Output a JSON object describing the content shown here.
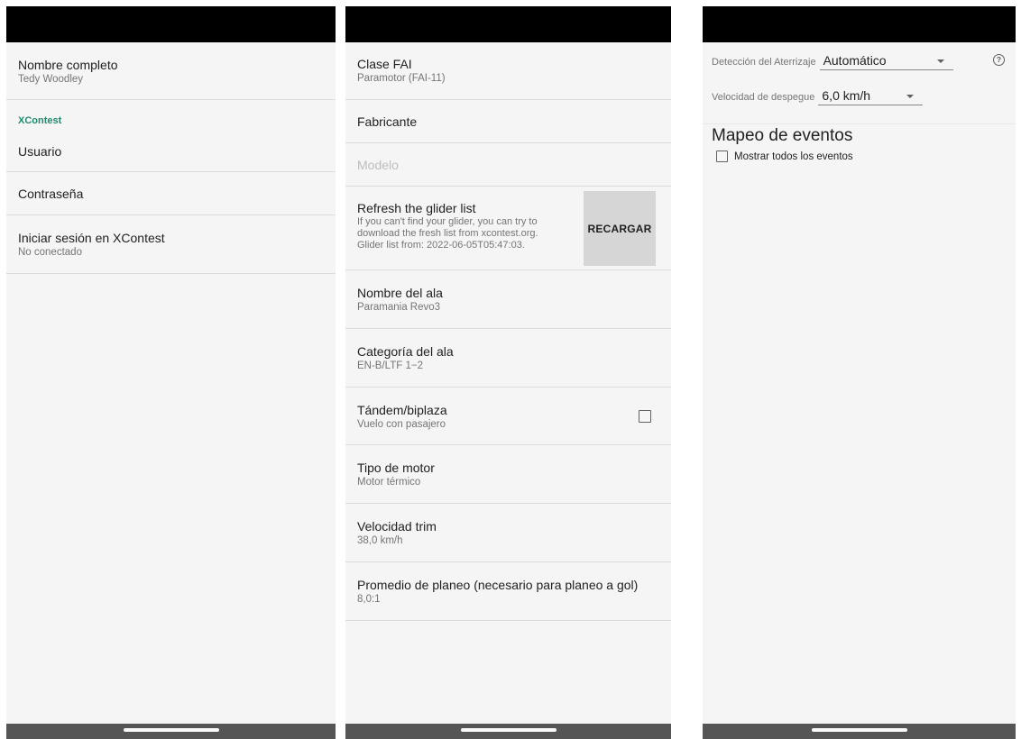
{
  "panel1": {
    "nombre": {
      "title": "Nombre completo",
      "summary": "Tedy Woodley"
    },
    "category": "XContest",
    "usuario": {
      "title": "Usuario"
    },
    "contrasena": {
      "title": "Contraseña"
    },
    "login": {
      "title": "Iniciar sesión en XContest",
      "summary": "No conectado"
    }
  },
  "panel2": {
    "clase": {
      "title": "Clase FAI",
      "summary": "Paramotor (FAI-11)"
    },
    "fabricante": {
      "title": "Fabricante"
    },
    "modelo": {
      "title": "Modelo"
    },
    "refresh": {
      "title": "Refresh the glider list",
      "line1": "If you can't find your glider, you can try to",
      "line2": "download the fresh list from xcontest.org.",
      "line3": "Glider list from: 2022-06-05T05:47:03.",
      "button": "RECARGAR"
    },
    "nombre_ala": {
      "title": "Nombre del ala",
      "summary": "Paramania Revo3"
    },
    "categoria": {
      "title": "Categoría del ala",
      "summary": "EN-B/LTF 1−2"
    },
    "tandem": {
      "title": "Tándem/biplaza",
      "summary": "Vuelo con pasajero",
      "checked": false
    },
    "motor": {
      "title": "Tipo de motor",
      "summary": "Motor térmico"
    },
    "trim": {
      "title": "Velocidad trim",
      "summary": "38,0 km/h"
    },
    "planeo": {
      "title": "Promedio de planeo (necesario para planeo a gol)",
      "summary": "8,0:1"
    }
  },
  "panel3": {
    "aterrizaje": {
      "label": "Detección del Aterrizaje",
      "value": "Automático"
    },
    "despegue": {
      "label": "Velocidad de despegue",
      "value": "6,0 km/h"
    },
    "help_icon": "?",
    "heading": "Mapeo de eventos",
    "show_all": {
      "label": "Mostrar todos los eventos",
      "checked": false
    }
  }
}
